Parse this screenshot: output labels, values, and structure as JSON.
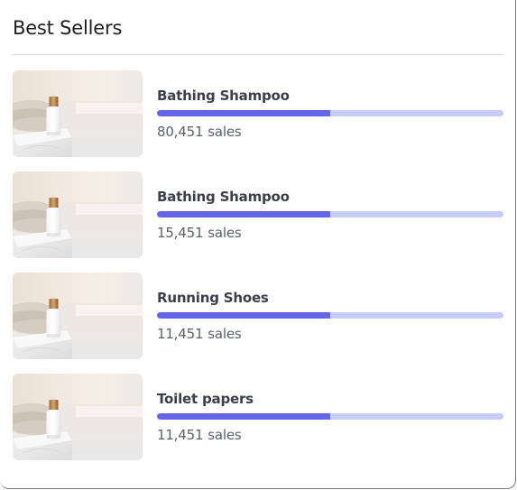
{
  "widget": {
    "title": "Best Sellers"
  },
  "products": [
    {
      "name": "Bathing Shampoo",
      "sales_count": "80,451",
      "sales_unit": "sales",
      "progress": 0.5,
      "image_icon": "product-image-icon"
    },
    {
      "name": "Bathing Shampoo",
      "sales_count": "15,451",
      "sales_unit": "sales",
      "progress": 0.5,
      "image_icon": "product-image-icon"
    },
    {
      "name": "Running Shoes",
      "sales_count": "11,451",
      "sales_unit": "sales",
      "progress": 0.5,
      "image_icon": "product-image-icon"
    },
    {
      "name": "Toilet papers",
      "sales_count": "11,451",
      "sales_unit": "sales",
      "progress": 0.5,
      "image_icon": "product-image-icon"
    }
  ],
  "colors": {
    "progress_fill": "#6366e8",
    "progress_track": "#c7cbf8",
    "title_text": "#1f1f1f",
    "name_text": "#3b3f4a",
    "sales_text": "#5a5f6a"
  }
}
